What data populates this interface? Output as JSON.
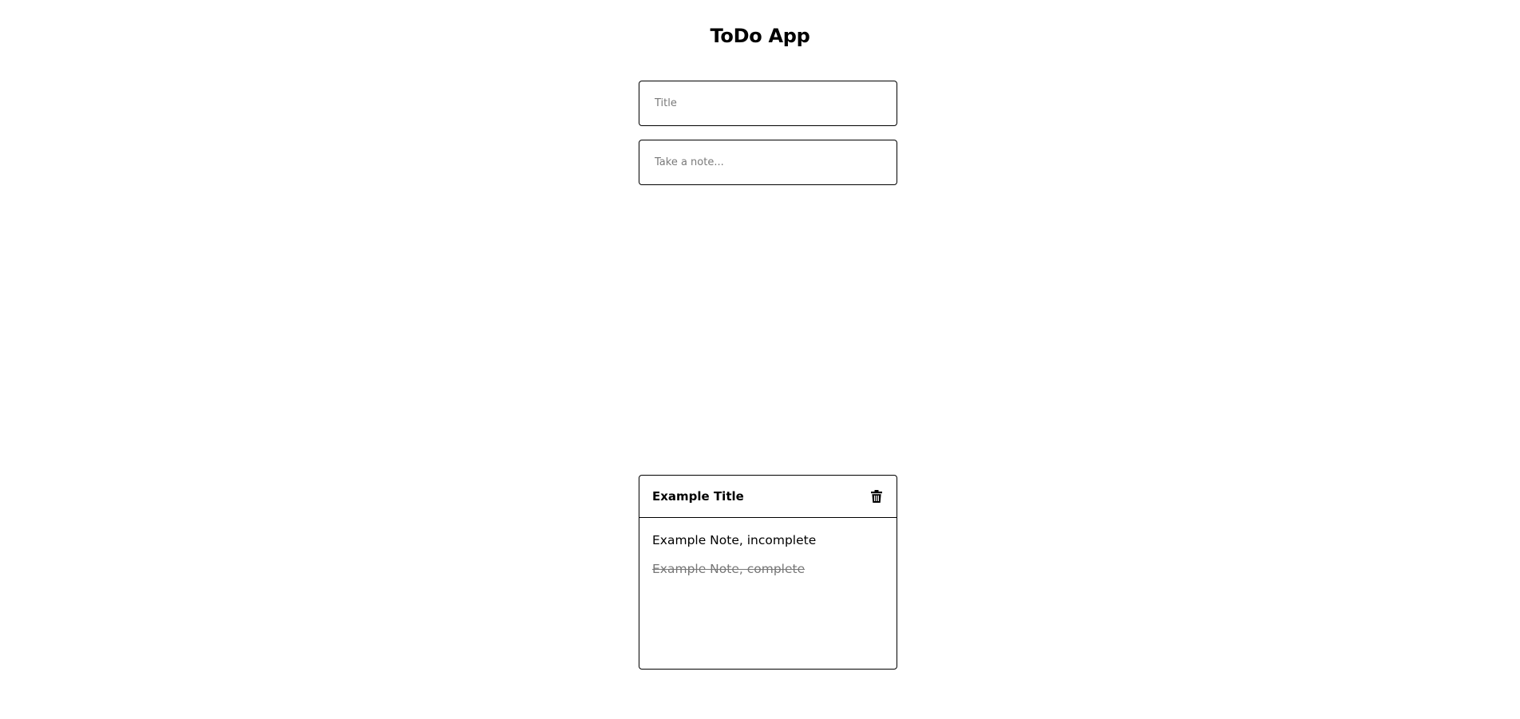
{
  "app": {
    "title": "ToDo App"
  },
  "form": {
    "title_placeholder": "Title",
    "note_placeholder": "Take a note..."
  },
  "cards": [
    {
      "title": "Example Title",
      "delete_icon": "trash-icon",
      "notes": [
        {
          "text": "Example Note, incomplete",
          "complete": false
        },
        {
          "text": "Example Note, complete",
          "complete": true
        }
      ]
    }
  ],
  "colors": {
    "border": "#000000",
    "placeholder": "#7a7a7a",
    "completed_note": "#777777"
  }
}
